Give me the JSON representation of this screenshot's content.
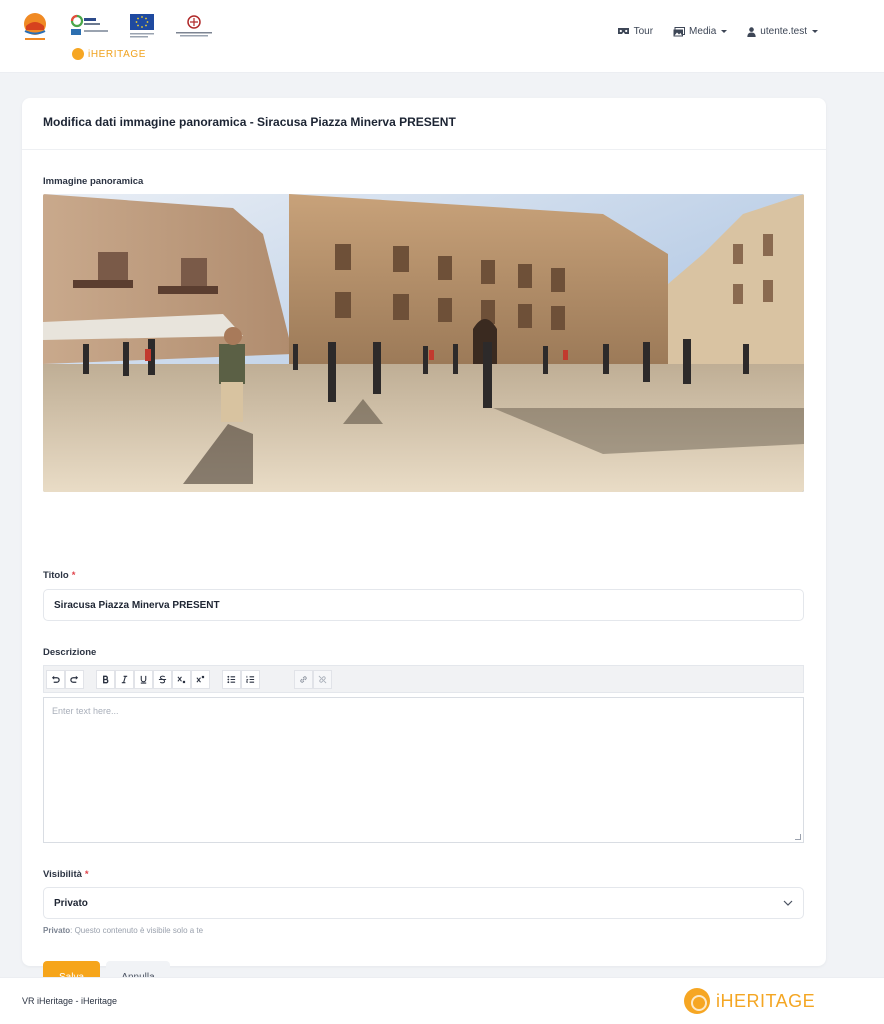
{
  "nav": {
    "brand": "iHERITAGE",
    "tour_label": "Tour",
    "media_label": "Media",
    "user_label": "utente.test"
  },
  "card": {
    "title": "Modifica dati immagine panoramica - Siracusa Piazza Minerva PRESENT"
  },
  "form": {
    "pano_label": "Immagine panoramica",
    "title_label": "Titolo",
    "required_mark": "*",
    "title_value": "Siracusa Piazza Minerva PRESENT",
    "description_label": "Descrizione",
    "description_placeholder": "Enter text here...",
    "visibility_label": "Visibilità",
    "visibility_value": "Privato",
    "hint_strong": "Privato",
    "hint_text": ": Questo contenuto è visibile solo a te",
    "save_label": "Salva",
    "cancel_label": "Annulla"
  },
  "footer": {
    "text": "VR iHeritage - iHeritage",
    "brand": "iHERITAGE"
  },
  "colors": {
    "accent": "#f6a51b",
    "required": "#e0434b"
  }
}
